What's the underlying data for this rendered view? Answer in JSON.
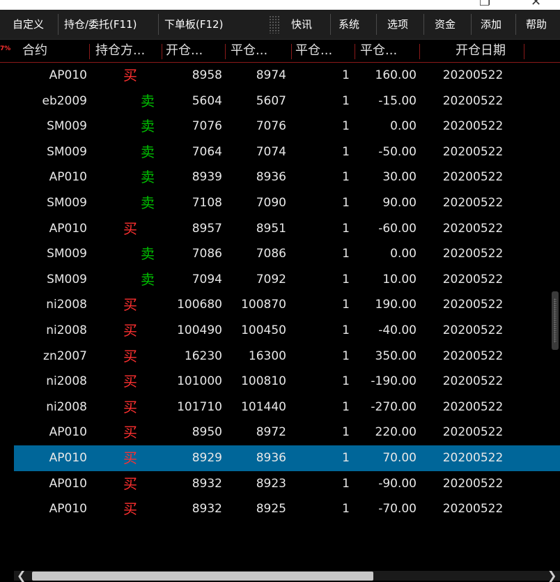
{
  "window": {
    "restore_glyph": "❐",
    "close_glyph": "✕"
  },
  "menu": {
    "items": [
      "自定义",
      "持仓/委托(F11)",
      "下单板(F12)",
      "快讯",
      "系统",
      "选项",
      "资金",
      "添加",
      "帮助"
    ]
  },
  "table": {
    "percent_badge": "7%",
    "headers": [
      "合约",
      "持仓方...",
      "开仓...",
      "平仓...",
      "平仓...",
      "平仓...",
      "开仓日期"
    ],
    "rows": [
      {
        "contract": "AP010",
        "direction": "买",
        "open_price": "8958",
        "close_price": "8974",
        "qty": "1",
        "pl": "160.00",
        "open_date": "20200522"
      },
      {
        "contract": "eb2009",
        "direction": "卖",
        "open_price": "5604",
        "close_price": "5607",
        "qty": "1",
        "pl": "-15.00",
        "open_date": "20200522"
      },
      {
        "contract": "SM009",
        "direction": "卖",
        "open_price": "7076",
        "close_price": "7076",
        "qty": "1",
        "pl": "0.00",
        "open_date": "20200522"
      },
      {
        "contract": "SM009",
        "direction": "卖",
        "open_price": "7064",
        "close_price": "7074",
        "qty": "1",
        "pl": "-50.00",
        "open_date": "20200522"
      },
      {
        "contract": "AP010",
        "direction": "卖",
        "open_price": "8939",
        "close_price": "8936",
        "qty": "1",
        "pl": "30.00",
        "open_date": "20200522"
      },
      {
        "contract": "SM009",
        "direction": "卖",
        "open_price": "7108",
        "close_price": "7090",
        "qty": "1",
        "pl": "90.00",
        "open_date": "20200522"
      },
      {
        "contract": "AP010",
        "direction": "买",
        "open_price": "8957",
        "close_price": "8951",
        "qty": "1",
        "pl": "-60.00",
        "open_date": "20200522"
      },
      {
        "contract": "SM009",
        "direction": "卖",
        "open_price": "7086",
        "close_price": "7086",
        "qty": "1",
        "pl": "0.00",
        "open_date": "20200522"
      },
      {
        "contract": "SM009",
        "direction": "卖",
        "open_price": "7094",
        "close_price": "7092",
        "qty": "1",
        "pl": "10.00",
        "open_date": "20200522"
      },
      {
        "contract": "ni2008",
        "direction": "买",
        "open_price": "100680",
        "close_price": "100870",
        "qty": "1",
        "pl": "190.00",
        "open_date": "20200522"
      },
      {
        "contract": "ni2008",
        "direction": "买",
        "open_price": "100490",
        "close_price": "100450",
        "qty": "1",
        "pl": "-40.00",
        "open_date": "20200522"
      },
      {
        "contract": "zn2007",
        "direction": "买",
        "open_price": "16230",
        "close_price": "16300",
        "qty": "1",
        "pl": "350.00",
        "open_date": "20200522"
      },
      {
        "contract": "ni2008",
        "direction": "买",
        "open_price": "101000",
        "close_price": "100810",
        "qty": "1",
        "pl": "-190.00",
        "open_date": "20200522"
      },
      {
        "contract": "ni2008",
        "direction": "买",
        "open_price": "101710",
        "close_price": "101440",
        "qty": "1",
        "pl": "-270.00",
        "open_date": "20200522"
      },
      {
        "contract": "AP010",
        "direction": "买",
        "open_price": "8950",
        "close_price": "8972",
        "qty": "1",
        "pl": "220.00",
        "open_date": "20200522"
      },
      {
        "contract": "AP010",
        "direction": "买",
        "open_price": "8929",
        "close_price": "8936",
        "qty": "1",
        "pl": "70.00",
        "open_date": "20200522"
      },
      {
        "contract": "AP010",
        "direction": "买",
        "open_price": "8932",
        "close_price": "8923",
        "qty": "1",
        "pl": "-90.00",
        "open_date": "20200522"
      },
      {
        "contract": "AP010",
        "direction": "买",
        "open_price": "8932",
        "close_price": "8925",
        "qty": "1",
        "pl": "-70.00",
        "open_date": "20200522"
      }
    ],
    "selected_row": 15
  },
  "scrollbar": {
    "left_arrow": "❮",
    "right_arrow": "❯"
  },
  "colors": {
    "buy": "#ff3030",
    "sell": "#00c000",
    "selection": "#006699",
    "header_rule": "#8b1a1a"
  }
}
